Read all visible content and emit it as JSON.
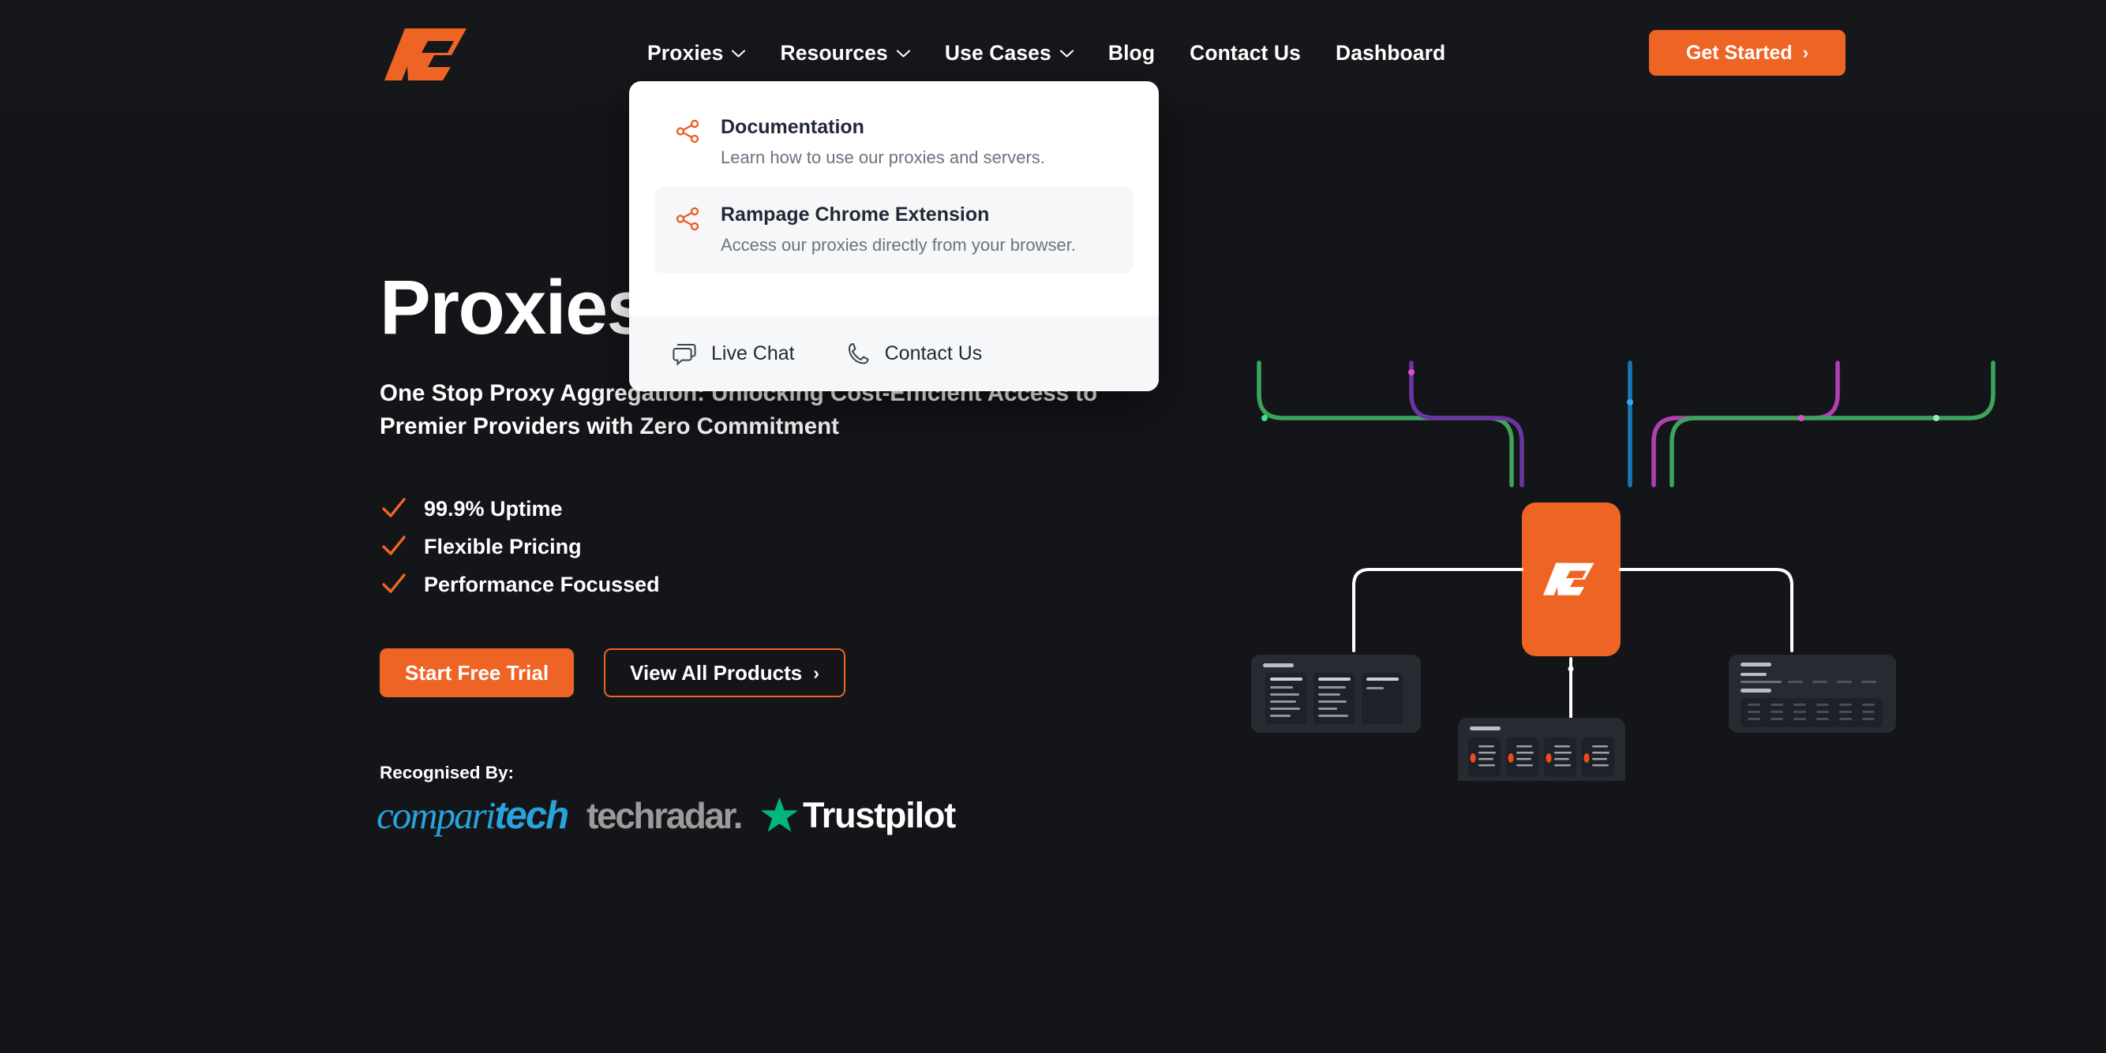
{
  "brand": {
    "name": "Rampage",
    "accent": "#ee6425",
    "background": "#141519",
    "header_bg": "#16171b"
  },
  "header": {
    "logo_name": "rampage-logo",
    "nav": [
      {
        "label": "Proxies",
        "has_caret": true
      },
      {
        "label": "Resources",
        "has_caret": true
      },
      {
        "label": "Use Cases",
        "has_caret": true
      },
      {
        "label": "Blog",
        "has_caret": false
      },
      {
        "label": "Contact Us",
        "has_caret": false
      },
      {
        "label": "Dashboard",
        "has_caret": false
      }
    ],
    "cta": {
      "label": "Get Started",
      "arrow": "›"
    }
  },
  "dropdown": {
    "open_for": "Resources",
    "items": [
      {
        "icon": "share-icon",
        "title": "Documentation",
        "description": "Learn how to use our proxies and servers.",
        "active": false
      },
      {
        "icon": "share-icon",
        "title": "Rampage Chrome Extension",
        "description": "Access our proxies directly from your browser.",
        "active": true
      }
    ],
    "footer": [
      {
        "icon": "chat-icon",
        "label": "Live Chat"
      },
      {
        "icon": "phone-icon",
        "label": "Contact Us"
      }
    ]
  },
  "hero": {
    "title": "Proxies",
    "subtitle": "One Stop Proxy Aggregation: Unlocking Cost-Efficient Access to Premier Providers with Zero Commitment",
    "features": [
      {
        "label": "99.9% Uptime"
      },
      {
        "label": "Flexible Pricing"
      },
      {
        "label": "Performance Focussed"
      }
    ],
    "buttons": {
      "primary": "Start Free Trial",
      "secondary": "View All Products",
      "secondary_arrow": "›"
    },
    "recognised_label": "Recognised By:",
    "logos": [
      {
        "name": "comparitech",
        "part_light": "compari",
        "part_bold": "tech",
        "color": "#29a3dc"
      },
      {
        "name": "techradar",
        "text": "techradar.",
        "color": "#9b9b9b"
      },
      {
        "name": "trustpilot",
        "text": "Trustpilot",
        "star_color": "#00b67a",
        "color": "#ffffff"
      }
    ]
  },
  "illustration": {
    "name": "proxy-network-diagram",
    "center_logo": "rampage-logo-tile",
    "line_colors": {
      "green": "#3da35d",
      "purple": "#7a3fa8",
      "magenta": "#b23fb2",
      "blue": "#1878b4",
      "white": "#ffffff"
    },
    "cards": [
      {
        "name": "list-card-left"
      },
      {
        "name": "grid-card-center"
      },
      {
        "name": "table-card-right"
      }
    ]
  }
}
